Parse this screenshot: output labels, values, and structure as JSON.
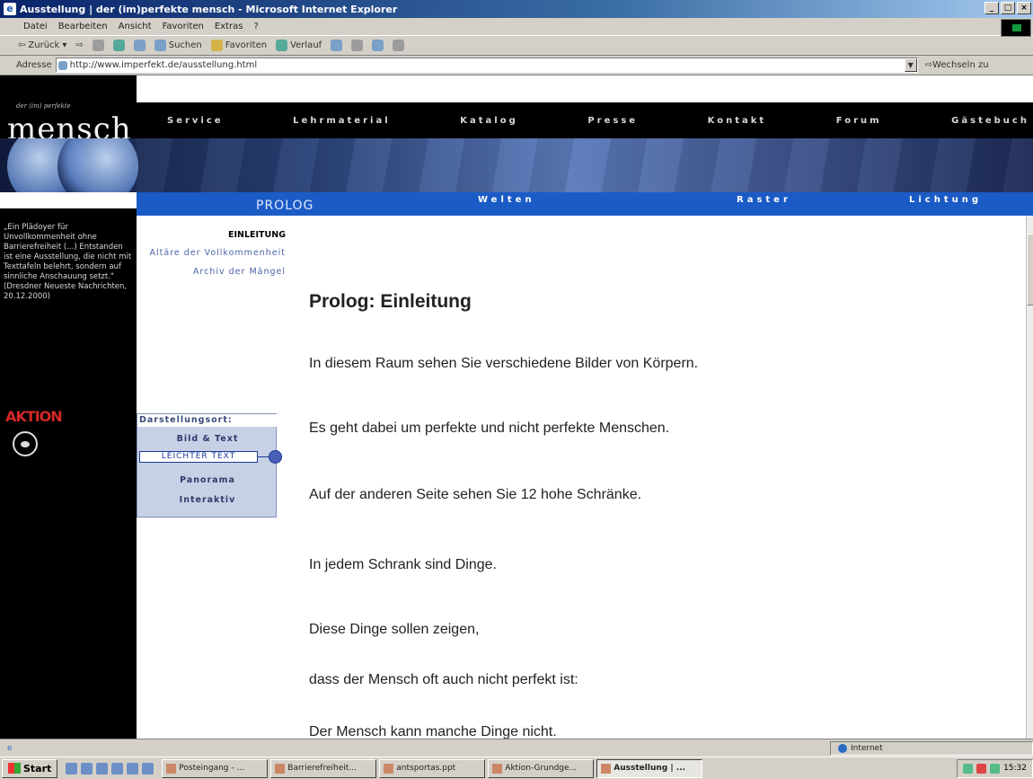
{
  "window": {
    "title": "Ausstellung | der (im)perfekte mensch - Microsoft Internet Explorer"
  },
  "menu": [
    "Datei",
    "Bearbeiten",
    "Ansicht",
    "Favoriten",
    "Extras",
    "?"
  ],
  "toolbar": {
    "back": "Zurück",
    "search": "Suchen",
    "favorites": "Favoriten",
    "history": "Verlauf"
  },
  "address": {
    "label": "Adresse",
    "url": "http://www.imperfekt.de/ausstellung.html",
    "go": "Wechseln zu"
  },
  "site": {
    "logo_sub": "der (im) perfekte",
    "logo": "mensch",
    "top_nav": [
      "Service",
      "Lehrmaterial",
      "Katalog",
      "Presse",
      "Kontakt",
      "Forum",
      "Gästebuch"
    ],
    "section": "PROLOG",
    "sub_nav": [
      "Welten",
      "Raster",
      "Lichtung"
    ],
    "quote": "„Ein Plädoyer für Unvollkommenheit ohne Barrierefreiheit (...) Entstanden ist eine Ausstellung, die nicht mit Texttafeln belehrt, sondern auf sinnliche Anschauung setzt.\" (Dresdner Neueste Nachrichten, 20.12.2000)",
    "aktion_logo": "AKTION"
  },
  "submenu": {
    "active": "EINLEITUNG",
    "items": [
      "Altäre der Vollkommenheit",
      "Archiv der Mängel"
    ]
  },
  "darstellung": {
    "heading": "Darstellungsort:",
    "options": [
      "Bild & Text",
      "LEICHTER TEXT",
      "Panorama",
      "Interaktiv"
    ],
    "selected_index": 1
  },
  "content": {
    "heading": "Prolog: Einleitung",
    "paragraphs": [
      "In diesem Raum sehen Sie verschiedene Bilder von Körpern.",
      "Es geht dabei um perfekte und nicht perfekte Menschen.",
      "Auf der anderen Seite sehen Sie 12 hohe Schränke.",
      "In jedem Schrank sind Dinge.",
      "Diese Dinge sollen zeigen,",
      "dass der Mensch oft auch nicht perfekt ist:",
      "Der Mensch kann manche Dinge nicht."
    ]
  },
  "status": {
    "zone": "Internet"
  },
  "taskbar": {
    "start": "Start",
    "tasks": [
      "Posteingang - ...",
      "Barrierefreiheit...",
      "antsportas.ppt",
      "Aktion-Grundge...",
      "Ausstellung | ..."
    ],
    "active_task": 4,
    "clock": "15:32"
  }
}
